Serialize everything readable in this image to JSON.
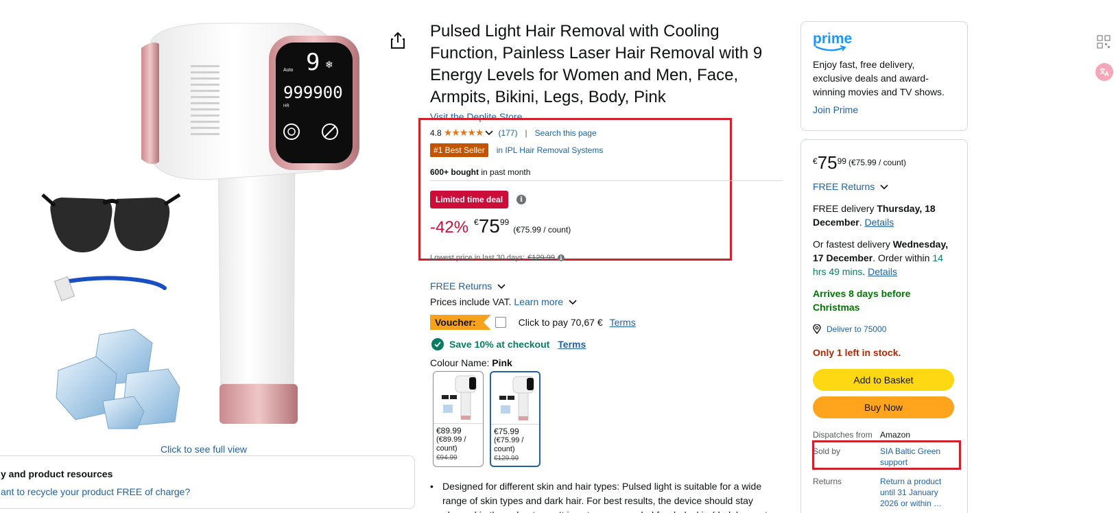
{
  "image_area": {
    "full_view_link": "Click to see full view",
    "resources_title": "y and product resources",
    "resources_link": "ant to recycle your product FREE of charge?",
    "device_display_level": "9",
    "device_display_count": "999900",
    "device_display_auto": "Auto",
    "device_display_hr": "HR"
  },
  "product": {
    "title": "Pulsed Light Hair Removal with Cooling Function, Painless Laser Hair Removal with 9 Energy Levels for Women and Men, Face, Armpits, Bikini, Legs, Body, Pink",
    "store_link": "Visit the Deplite Store",
    "rating_value": "4.8",
    "stars": "★★★★★",
    "rating_count": "(177)",
    "separator": "|",
    "search_page": "Search this page",
    "best_seller_badge": "#1 Best Seller",
    "best_seller_category": "in IPL Hair Removal Systems",
    "bought_bold": "600+ bought",
    "bought_rest": " in past month",
    "deal_badge": "Limited time deal",
    "discount": "-42%",
    "currency": "€",
    "price_whole": "75",
    "price_fraction": "99",
    "unit_price": "(€75.99 / count)",
    "lowest_label": "Lowest price in last 30 days: ",
    "lowest_price": "€129.99",
    "free_returns": "FREE Returns",
    "vat_text": "Prices include VAT. ",
    "learn_more": "Learn more",
    "voucher_label": "Voucher:",
    "voucher_click": "Click to pay 70,67 €",
    "voucher_terms": "Terms",
    "save_text": "Save 10% at checkout",
    "save_terms": "Terms",
    "colour_label": "Colour Name: ",
    "colour_value": "Pink",
    "variants": [
      {
        "price": "€89.99",
        "unit": "(€89.99 / count)",
        "old": "€94.99"
      },
      {
        "price": "€75.99",
        "unit": "(€75.99 / count)",
        "old": "€129.99"
      }
    ],
    "bullet_1": "Designed for different skin and hair types: Pulsed light is suitable for a wide range of skin types and dark hair. For best results, the device should stay plugged in throughout use. It is not recommended for dark skin (dark brown to black) or very light hair (blonds, red, gray or white). Not recommended for"
  },
  "prime": {
    "logo": "prime",
    "text": "Enjoy fast, free delivery, exclusive deals and award-winning movies and TV shows.",
    "join": "Join Prime"
  },
  "buy_box": {
    "currency": "€",
    "price_whole": "75",
    "price_fraction": "99",
    "unit_price": "(€75.99 / count)",
    "free_returns": "FREE Returns",
    "delivery_prefix": "FREE delivery ",
    "delivery_date": "Thursday, 18 December",
    "delivery_details": "Details",
    "fast_prefix": "Or fastest delivery ",
    "fast_date": "Wednesday, 17 December",
    "fast_order": ". Order within ",
    "fast_countdown": "14 hrs 49 mins",
    "fast_details": "Details",
    "arrives": "Arrives 8 days before Christmas",
    "deliver_to": "Deliver to  75000",
    "stock": "Only 1 left in stock.",
    "add_to_basket": "Add to Basket",
    "buy_now": "Buy Now",
    "dispatches_label": "Dispatches from",
    "dispatches_value": "Amazon",
    "sold_by_label": "Sold by",
    "sold_by_value": "SIA Baltic Green support",
    "returns_label": "Returns",
    "returns_value": "Return a product until 31 January 2026 or within …"
  },
  "colors": {
    "link": "#2162a1",
    "deal_red": "#cc0c39",
    "best_seller": "#c45500",
    "add_to_basket": "#ffd814",
    "buy_now": "#ffa41c",
    "annotation_red": "#d0202c"
  }
}
